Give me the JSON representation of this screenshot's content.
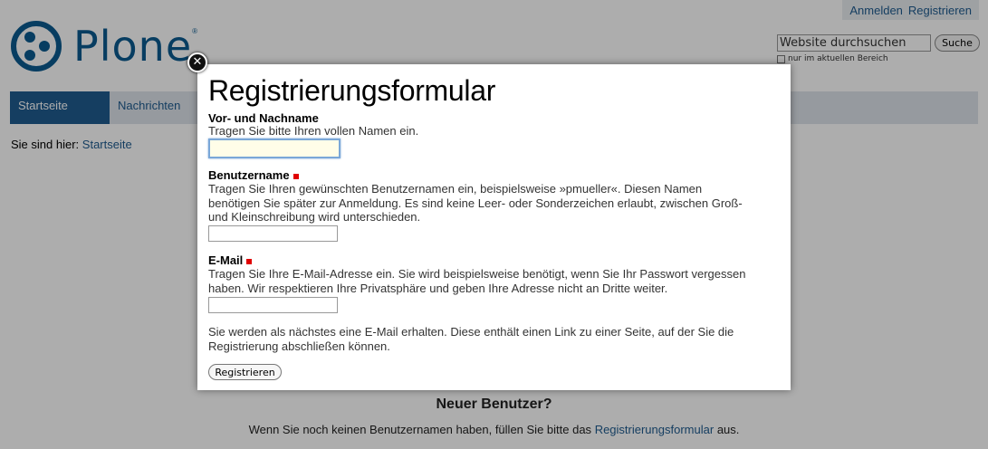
{
  "personal_bar": {
    "login": "Anmelden",
    "register": "Registrieren"
  },
  "logo": {
    "text": "Plone",
    "reg_mark": "®"
  },
  "search": {
    "placeholder": "Website durchsuchen",
    "button": "Suche",
    "option": "nur im aktuellen Bereich"
  },
  "nav": {
    "tabs": [
      {
        "label": "Startseite"
      },
      {
        "label": "Nachrichten"
      }
    ]
  },
  "breadcrumbs": {
    "prefix": "Sie sind hier:",
    "home": "Startseite"
  },
  "page": {
    "new_user_title": "Neuer Benutzer?",
    "new_user_text_before": "Wenn Sie noch keinen Benutzernamen haben, füllen Sie bitte das",
    "new_user_link": "Registrierungsformular",
    "new_user_text_after": "aus."
  },
  "modal": {
    "title": "Registrierungsformular",
    "close_symbol": "✕",
    "fields": [
      {
        "label": "Vor- und Nachname",
        "help": "Tragen Sie bitte Ihren vollen Namen ein.",
        "required": false,
        "value": ""
      },
      {
        "label": "Benutzername",
        "help": "Tragen Sie Ihren gewünschten Benutzernamen ein, beispielsweise »pmueller«. Diesen Namen benötigen Sie später zur Anmeldung. Es sind keine Leer- oder Sonderzeichen erlaubt, zwischen Groß- und Kleinschreibung wird unterschieden.",
        "required": true,
        "value": ""
      },
      {
        "label": "E-Mail",
        "help": "Tragen Sie Ihre E-Mail-Adresse ein. Sie wird beispielsweise benötigt, wenn Sie Ihr Passwort vergessen haben. Wir respektieren Ihre Privatsphäre und geben Ihre Adresse nicht an Dritte weiter.",
        "required": true,
        "value": ""
      }
    ],
    "note": "Sie werden als nächstes eine E-Mail erhalten. Diese enthält einen Link zu einer Seite, auf der Sie die Registrierung abschließen können.",
    "submit": "Registrieren"
  },
  "colors": {
    "accent": "#205c90",
    "logo": "#0b5a8f",
    "required_marker": "#e00000"
  }
}
